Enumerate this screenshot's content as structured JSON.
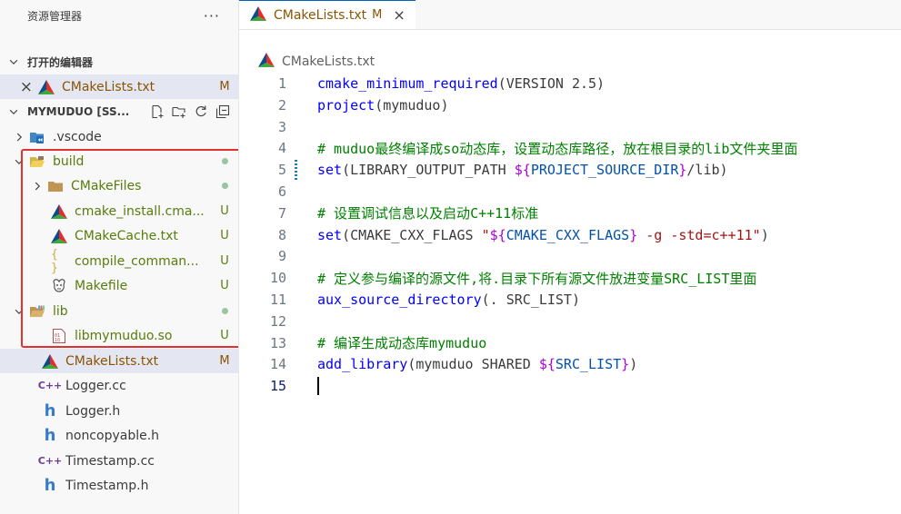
{
  "explorer": {
    "title": "资源管理器",
    "more": "···",
    "open_editors": {
      "header": "打开的编辑器",
      "items": [
        {
          "close": "×",
          "label": "CMakeLists.txt",
          "badge": "M"
        }
      ]
    },
    "folder": {
      "header": "MYMUDUO [SS...",
      "items": [
        {
          "label": ".vscode",
          "badge": ""
        },
        {
          "label": "build",
          "badge": "dot"
        },
        {
          "label": "CMakeFiles",
          "badge": "dot"
        },
        {
          "label": "cmake_install.cma...",
          "badge": "U"
        },
        {
          "label": "CMakeCache.txt",
          "badge": "U"
        },
        {
          "label": "compile_comman...",
          "badge": "U"
        },
        {
          "label": "Makefile",
          "badge": "U"
        },
        {
          "label": "lib",
          "badge": "dot"
        },
        {
          "label": "libmymuduo.so",
          "badge": "U"
        },
        {
          "label": "CMakeLists.txt",
          "badge": "M"
        },
        {
          "label": "Logger.cc",
          "badge": ""
        },
        {
          "label": "Logger.h",
          "badge": ""
        },
        {
          "label": "noncopyable.h",
          "badge": ""
        },
        {
          "label": "Timestamp.cc",
          "badge": ""
        },
        {
          "label": "Timestamp.h",
          "badge": ""
        }
      ]
    },
    "icons": {
      "cpp_glyph": "C++",
      "header_glyph": "h",
      "json_glyph": "{ }"
    }
  },
  "editor": {
    "tab": {
      "label": "CMakeLists.txt",
      "modified": "M",
      "close": "×"
    },
    "breadcrumb": "CMakeLists.txt",
    "lines": [
      {
        "n": "1",
        "parts": [
          [
            "f",
            "cmake_minimum_required"
          ],
          [
            "p",
            "(VERSION 2.5)"
          ]
        ]
      },
      {
        "n": "2",
        "parts": [
          [
            "f",
            "project"
          ],
          [
            "p",
            "(mymuduo)"
          ]
        ]
      },
      {
        "n": "3",
        "parts": []
      },
      {
        "n": "4",
        "parts": [
          [
            "c",
            "# muduo最终编译成so动态库，设置动态库路径，放在根目录的lib文件夹里面"
          ]
        ]
      },
      {
        "n": "5",
        "parts": [
          [
            "f",
            "set"
          ],
          [
            "p",
            "(LIBRARY_OUTPUT_PATH "
          ],
          [
            "d",
            "${"
          ],
          [
            "v",
            "PROJECT_SOURCE_DIR"
          ],
          [
            "d",
            "}"
          ],
          [
            "p",
            "/lib)"
          ]
        ]
      },
      {
        "n": "6",
        "parts": []
      },
      {
        "n": "7",
        "parts": [
          [
            "c",
            "# 设置调试信息以及启动C++11标准"
          ]
        ]
      },
      {
        "n": "8",
        "parts": [
          [
            "f",
            "set"
          ],
          [
            "p",
            "(CMAKE_CXX_FLAGS "
          ],
          [
            "s",
            "\""
          ],
          [
            "d",
            "${"
          ],
          [
            "v",
            "CMAKE_CXX_FLAGS"
          ],
          [
            "d",
            "}"
          ],
          [
            "s",
            " -g -std=c++11\""
          ],
          [
            "p",
            ")"
          ]
        ]
      },
      {
        "n": "9",
        "parts": []
      },
      {
        "n": "10",
        "parts": [
          [
            "c",
            "# 定义参与编译的源文件,将.目录下所有源文件放进变量SRC_LIST里面"
          ]
        ]
      },
      {
        "n": "11",
        "parts": [
          [
            "f",
            "aux_source_directory"
          ],
          [
            "p",
            "(. SRC_LIST)"
          ]
        ]
      },
      {
        "n": "12",
        "parts": []
      },
      {
        "n": "13",
        "parts": [
          [
            "c",
            "# 编译生成动态库mymuduo"
          ]
        ]
      },
      {
        "n": "14",
        "parts": [
          [
            "f",
            "add_library"
          ],
          [
            "p",
            "(mymuduo SHARED "
          ],
          [
            "d",
            "${"
          ],
          [
            "v",
            "SRC_LIST"
          ],
          [
            "d",
            "}"
          ],
          [
            "p",
            ")"
          ]
        ]
      },
      {
        "n": "15",
        "parts": []
      }
    ],
    "active_line": "15"
  }
}
